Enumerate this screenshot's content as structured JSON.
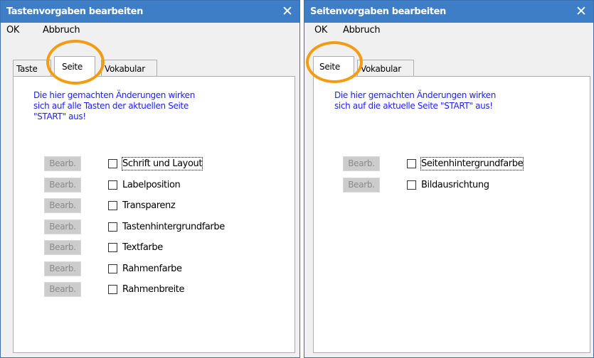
{
  "left_window": {
    "title": "Tastenvorgaben bearbeiten",
    "close_glyph": "✕",
    "menu": {
      "ok": "OK",
      "cancel": "Abbruch"
    },
    "tabs": [
      "Taste",
      "Seite",
      "Vokabular"
    ],
    "active_tab": "Seite",
    "info": "Die hier gemachten Änderungen wirken\nsich auf alle Tasten der aktuellen Seite\n\"START\" aus!",
    "edit_label": "Bearb.",
    "options": [
      "Schrift und Layout",
      "Labelposition",
      "Transparenz",
      "Tastenhintergrundfarbe",
      "Textfarbe",
      "Rahmenfarbe",
      "Rahmenbreite"
    ]
  },
  "right_window": {
    "title": "Seitenvorgaben bearbeiten",
    "close_glyph": "✕",
    "menu": {
      "ok": "OK",
      "cancel": "Abbruch"
    },
    "tabs": [
      "Seite",
      "Vokabular"
    ],
    "active_tab": "Seite",
    "info": "Die hier gemachten Änderungen wirken\nsich auf die aktuelle Seite \"START\" aus!",
    "edit_label": "Bearb.",
    "options": [
      "Seitenhintergrundfarbe",
      "Bildausrichtung"
    ]
  },
  "colors": {
    "titlebar": "#3d7ec7",
    "info_text": "#2020ff",
    "highlight": "#f39c12"
  },
  "icons": {
    "close": "close-icon"
  }
}
